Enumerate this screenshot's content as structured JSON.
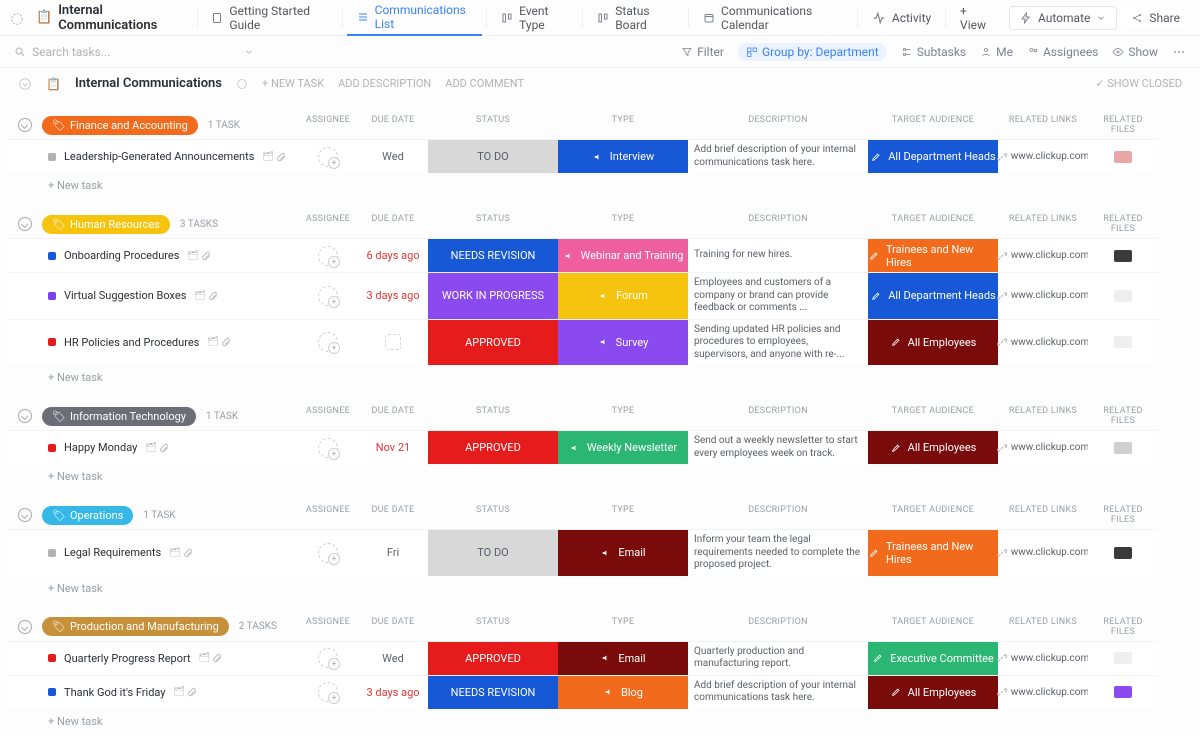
{
  "topbar": {
    "title": "Internal Communications",
    "tabs": [
      {
        "name": "getting-started",
        "label": "Getting Started Guide"
      },
      {
        "name": "communications-list",
        "label": "Communications List",
        "active": true
      },
      {
        "name": "event-type",
        "label": "Event Type"
      },
      {
        "name": "status-board",
        "label": "Status Board"
      },
      {
        "name": "communications-calendar",
        "label": "Communications Calendar"
      },
      {
        "name": "activity",
        "label": "Activity"
      }
    ],
    "add_view": "+  View",
    "automate": "Automate",
    "share": "Share"
  },
  "toolbar": {
    "search_placeholder": "Search tasks...",
    "filter": "Filter",
    "group_by": "Group by: Department",
    "subtasks": "Subtasks",
    "me": "Me",
    "assignees": "Assignees",
    "show": "Show"
  },
  "breadcrumb": {
    "title": "Internal Communications",
    "new_task": "+ NEW TASK",
    "add_description": "ADD DESCRIPTION",
    "add_comment": "ADD COMMENT",
    "show_closed": "SHOW CLOSED"
  },
  "columns": [
    "",
    "ASSIGNEE",
    "DUE DATE",
    "STATUS",
    "TYPE",
    "DESCRIPTION",
    "TARGET AUDIENCE",
    "RELATED LINKS",
    "RELATED FILES"
  ],
  "new_task_label": "+ New task",
  "link_default": "www.clickup.com",
  "groups": [
    {
      "name": "Finance and Accounting",
      "color": "#f26b1d",
      "task_count": "1 TASK",
      "tasks": [
        {
          "sq": "#b3b3b3",
          "name": "Leadership-Generated Announcements",
          "due": "Wed",
          "due_color": "#5a5f66",
          "status": "TO DO",
          "status_bg": "#d8d8d8",
          "status_fg": "#5a5f66",
          "type": "Interview",
          "type_bg": "#1758d6",
          "desc": "Add brief description of your internal communications task here.",
          "audience": "All Department Heads",
          "aud_bg": "#1758d6",
          "link": "www.clickup.com",
          "file_bg": "#e9a7a7"
        }
      ]
    },
    {
      "name": "Human Resources",
      "color": "#f6c40f",
      "task_count": "3 TASKS",
      "tasks": [
        {
          "sq": "#1758d6",
          "name": "Onboarding Procedures",
          "due": "6 days ago",
          "due_color": "#e03434",
          "status": "NEEDS REVISION",
          "status_bg": "#1758d6",
          "status_fg": "#fff",
          "type": "Webinar and Training",
          "type_bg": "#ef5fa0",
          "desc": "Training for new hires.",
          "audience": "Trainees and New Hires",
          "aud_bg": "#f26b1d",
          "link": "www.clickup.com",
          "file_bg": "#3a3a3a"
        },
        {
          "sq": "#7a3ff0",
          "name": "Virtual Suggestion Boxes",
          "due": "3 days ago",
          "due_color": "#e03434",
          "status": "WORK IN PROGRESS",
          "status_bg": "#8a4af0",
          "status_fg": "#fff",
          "type": "Forum",
          "type_bg": "#f6c40f",
          "desc": "Employees and customers of a company or brand can provide feedback or comments ...",
          "audience": "All Department Heads",
          "aud_bg": "#1758d6",
          "link": "www.clickup.com",
          "file_bg": "#efefef"
        },
        {
          "sq": "#e61b1b",
          "name": "HR Policies and Procedures",
          "due": "",
          "due_color": "",
          "status": "APPROVED",
          "status_bg": "#e61b1b",
          "status_fg": "#fff",
          "type": "Survey",
          "type_bg": "#8a4af0",
          "desc": "Sending updated HR policies and procedures to employees, supervisors, and anyone with re-...",
          "audience": "All Employees",
          "aud_bg": "#7a0b0b",
          "link": "www.clickup.com",
          "file_bg": "#efefef"
        }
      ]
    },
    {
      "name": "Information Technology",
      "color": "#6b6e76",
      "task_count": "1 TASK",
      "tasks": [
        {
          "sq": "#e61b1b",
          "name": "Happy Monday",
          "due": "Nov 21",
          "due_color": "#e03434",
          "status": "APPROVED",
          "status_bg": "#e61b1b",
          "status_fg": "#fff",
          "type": "Weekly Newsletter",
          "type_bg": "#2bb673",
          "desc": "Send out a weekly newsletter to start every employees week on track.",
          "audience": "All Employees",
          "aud_bg": "#7a0b0b",
          "link": "www.clickup.com",
          "file_bg": "#cfcfcf"
        }
      ]
    },
    {
      "name": "Operations",
      "color": "#35b8e8",
      "task_count": "1 TASK",
      "tasks": [
        {
          "sq": "#b3b3b3",
          "name": "Legal Requirements",
          "due": "Fri",
          "due_color": "#5a5f66",
          "status": "TO DO",
          "status_bg": "#d8d8d8",
          "status_fg": "#5a5f66",
          "type": "Email",
          "type_bg": "#7a0b0b",
          "desc": "Inform your team the legal requirements needed to complete the proposed project.",
          "audience": "Trainees and New Hires",
          "aud_bg": "#f26b1d",
          "link": "www.clickup.com",
          "file_bg": "#3a3a3a"
        }
      ]
    },
    {
      "name": "Production and Manufacturing",
      "color": "#c7903a",
      "task_count": "2 TASKS",
      "tasks": [
        {
          "sq": "#e61b1b",
          "name": "Quarterly Progress Report",
          "due": "Wed",
          "due_color": "#5a5f66",
          "status": "APPROVED",
          "status_bg": "#e61b1b",
          "status_fg": "#fff",
          "type": "Email",
          "type_bg": "#7a0b0b",
          "desc": "Quarterly production and manufacturing report.",
          "audience": "Executive Committee",
          "aud_bg": "#2bb673",
          "link": "www.clickup.com",
          "file_bg": "#efefef"
        },
        {
          "sq": "#1758d6",
          "name": "Thank God it's Friday",
          "due": "3 days ago",
          "due_color": "#e03434",
          "status": "NEEDS REVISION",
          "status_bg": "#1758d6",
          "status_fg": "#fff",
          "type": "Blog",
          "type_bg": "#f26b1d",
          "desc": "Add brief description of your internal communications task here.",
          "audience": "All Employees",
          "aud_bg": "#7a0b0b",
          "link": "www.clickup.com",
          "file_bg": "#8a4af0"
        }
      ]
    }
  ]
}
